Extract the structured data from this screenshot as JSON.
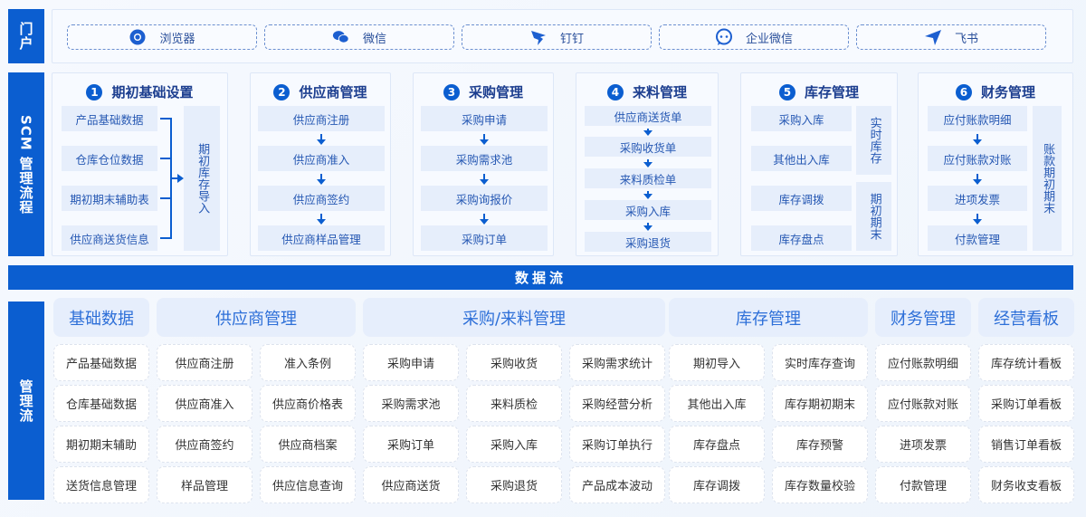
{
  "sidebar": {
    "portal": "门户",
    "scm": "SCM 管理流程",
    "mgmt": "管理流"
  },
  "portal": [
    {
      "label": "浏览器",
      "icon": "chrome-icon"
    },
    {
      "label": "微信",
      "icon": "wechat-icon"
    },
    {
      "label": "钉钉",
      "icon": "dingtalk-icon"
    },
    {
      "label": "企业微信",
      "icon": "wecom-icon"
    },
    {
      "label": "飞书",
      "icon": "feishu-icon"
    }
  ],
  "scm": [
    {
      "num": "1",
      "title": "期初基础设置",
      "items": [
        "产品基础数据",
        "仓库仓位数据",
        "期初期末辅助表",
        "供应商送货信息"
      ],
      "side": [
        "期初库存导入"
      ]
    },
    {
      "num": "2",
      "title": "供应商管理",
      "items": [
        "供应商注册",
        "供应商准入",
        "供应商签约",
        "供应商样品管理"
      ]
    },
    {
      "num": "3",
      "title": "采购管理",
      "items": [
        "采购申请",
        "采购需求池",
        "采购询报价",
        "采购订单"
      ]
    },
    {
      "num": "4",
      "title": "来料管理",
      "items": [
        "供应商送货单",
        "采购收货单",
        "来料质检单",
        "采购入库",
        "采购退货"
      ]
    },
    {
      "num": "5",
      "title": "库存管理",
      "items": [
        "采购入库",
        "其他出入库",
        "库存调拨",
        "库存盘点"
      ],
      "side": [
        "实时库存",
        "期初期末"
      ]
    },
    {
      "num": "6",
      "title": "财务管理",
      "items": [
        "应付账款明细",
        "应付账款对账",
        "进项发票",
        "付款管理"
      ],
      "side": [
        "账款期初期末"
      ]
    }
  ],
  "dataflow": "数据流",
  "mgmt": {
    "headers": [
      "基础数据",
      "供应商管理",
      "采购/来料管理",
      "库存管理",
      "财务管理",
      "经营看板"
    ],
    "columns": [
      [
        "产品基础数据",
        "仓库基础数据",
        "期初期末辅助",
        "送货信息管理"
      ],
      [
        "供应商注册",
        "供应商准入",
        "供应商签约",
        "样品管理"
      ],
      [
        "准入条例",
        "供应商价格表",
        "供应商档案",
        "供应信息查询"
      ],
      [
        "采购申请",
        "采购需求池",
        "采购订单",
        "供应商送货"
      ],
      [
        "采购收货",
        "来料质检",
        "采购入库",
        "采购退货"
      ],
      [
        "采购需求统计",
        "采购经营分析",
        "采购订单执行",
        "产品成本波动"
      ],
      [
        "期初导入",
        "其他出入库",
        "库存盘点",
        "库存调拨"
      ],
      [
        "实时库存查询",
        "库存期初期末",
        "库存预警",
        "库存数量校验"
      ],
      [
        "应付账款明细",
        "应付账款对账",
        "进项发票",
        "付款管理"
      ],
      [
        "库存统计看板",
        "采购订单看板",
        "销售订单看板",
        "财务收支看板"
      ]
    ]
  },
  "colors": {
    "accent": "#0B5ED0",
    "item_bg": "#E6EEFB"
  }
}
